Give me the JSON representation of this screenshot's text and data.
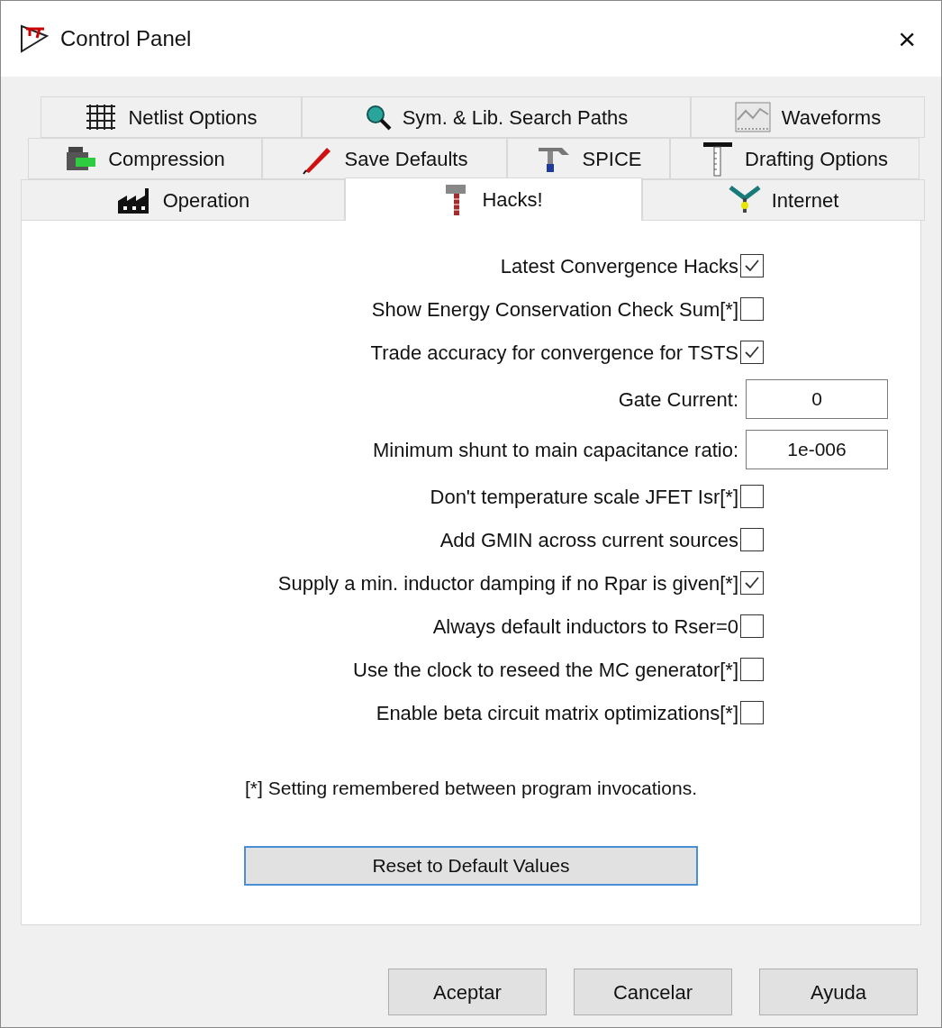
{
  "window": {
    "title": "Control Panel",
    "close": "×"
  },
  "tab_rows": [
    [
      {
        "label": "Netlist Options",
        "selected": false
      },
      {
        "label": "Sym. & Lib. Search Paths",
        "selected": false
      },
      {
        "label": "Waveforms",
        "selected": false
      }
    ],
    [
      {
        "label": "Compression",
        "selected": false
      },
      {
        "label": "Save Defaults",
        "selected": false
      },
      {
        "label": "SPICE",
        "selected": false
      },
      {
        "label": "Drafting Options",
        "selected": false
      }
    ],
    [
      {
        "label": "Operation",
        "selected": false
      },
      {
        "label": "Hacks!",
        "selected": true
      },
      {
        "label": "Internet",
        "selected": false
      }
    ]
  ],
  "settings": [
    {
      "kind": "checkbox",
      "label": "Latest Convergence Hacks",
      "checked": true
    },
    {
      "kind": "checkbox",
      "label": "Show Energy Conservation Check Sum[*]",
      "checked": false
    },
    {
      "kind": "checkbox",
      "label": "Trade accuracy for convergence for TSTS",
      "checked": true
    },
    {
      "kind": "number",
      "label": "Gate Current:",
      "value": "0"
    },
    {
      "kind": "number",
      "label": "Minimum shunt to main capacitance ratio:",
      "value": "1e-006"
    },
    {
      "kind": "checkbox",
      "label": "Don't temperature scale JFET Isr[*]",
      "checked": false
    },
    {
      "kind": "checkbox",
      "label": "Add GMIN across current sources",
      "checked": false
    },
    {
      "kind": "checkbox",
      "label": "Supply a min. inductor damping if no Rpar is given[*]",
      "checked": true
    },
    {
      "kind": "checkbox",
      "label": "Always default inductors to Rser=0",
      "checked": false
    },
    {
      "kind": "checkbox",
      "label": "Use the clock to reseed the MC generator[*]",
      "checked": false
    },
    {
      "kind": "checkbox",
      "label": "Enable beta circuit matrix optimizations[*]",
      "checked": false
    }
  ],
  "footnote": "[*] Setting remembered between program invocations.",
  "reset_button": "Reset to Default Values",
  "buttons": [
    "Aceptar",
    "Cancelar",
    "Ayuda"
  ]
}
